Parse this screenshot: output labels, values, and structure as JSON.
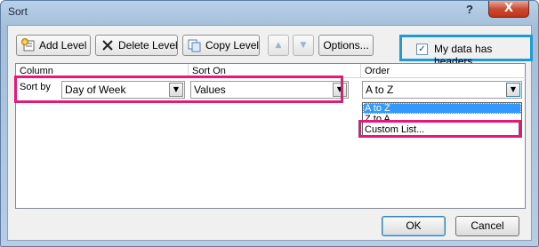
{
  "window": {
    "title": "Sort",
    "help_glyph": "?",
    "close_glyph": "X"
  },
  "toolbar": {
    "add_level": "Add Level",
    "delete_level": "Delete Level",
    "copy_level": "Copy Level",
    "move_up_glyph": "▲",
    "move_down_glyph": "▼",
    "options": "Options...",
    "headers_checked": true,
    "headers_label": "My data has headers"
  },
  "grid": {
    "columns": {
      "column": "Column",
      "sort_on": "Sort On",
      "order": "Order"
    },
    "row": {
      "label": "Sort by",
      "column_value": "Day of Week",
      "sort_on_value": "Values",
      "order_value": "A to Z"
    },
    "order_options": [
      "A to Z",
      "Z to A",
      "Custom List..."
    ],
    "selected_option": "A to Z"
  },
  "footer": {
    "ok": "OK",
    "cancel": "Cancel"
  },
  "colors": {
    "highlight_pink": "#e4197a",
    "highlight_blue": "#1e9bd7"
  }
}
